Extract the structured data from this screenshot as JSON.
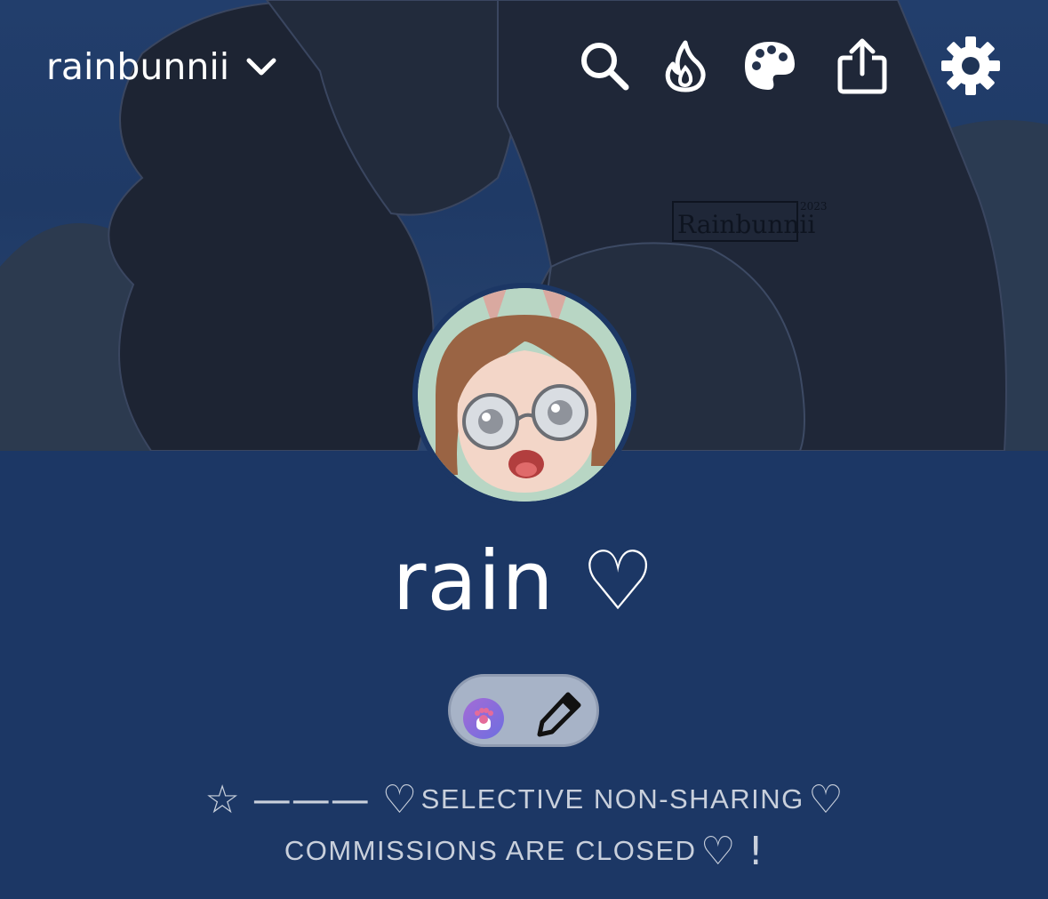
{
  "header": {
    "blog_name": "rainbunnii",
    "icons": [
      "search-icon",
      "flame-icon",
      "palette-icon",
      "share-icon",
      "gear-icon"
    ]
  },
  "header_art": {
    "signature": "Rainbunnii",
    "signature_year": "2023"
  },
  "profile": {
    "title": "rain ♡",
    "badge_icons": [
      "paw-badge-icon",
      "pencil-icon"
    ]
  },
  "description": {
    "line1_symbols": "☆ ——— ♡",
    "line1_text": "SELECTIVE NON-SHARING",
    "line1_end": "♡",
    "line2_text": "COMMISSIONS ARE CLOSED",
    "line2_end": "♡ !"
  },
  "colors": {
    "page_background": "#1c3765",
    "header_sky": "#223e6c",
    "badge_pill": "#a7b3c7",
    "description_text": "#c9d0dc"
  }
}
